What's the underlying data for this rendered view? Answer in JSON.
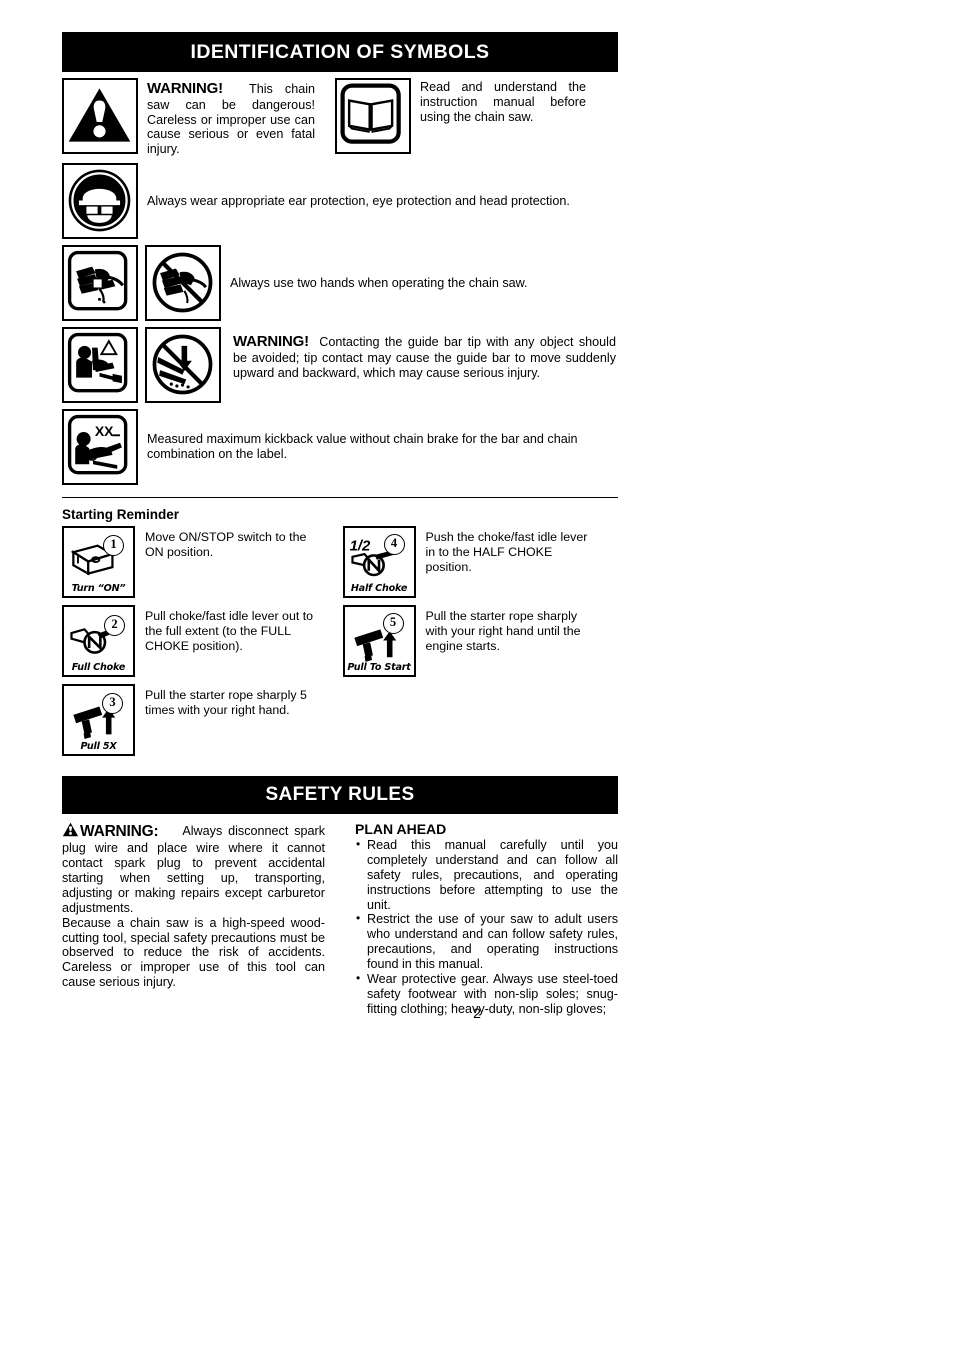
{
  "sections": {
    "identification": {
      "title": "IDENTIFICATION OF SYMBOLS",
      "rows": [
        {
          "icons": [
            "warning-triangle-icon"
          ],
          "warning_label": "WARNING!",
          "text": "This chain saw can be dangerous! Careless or improper use can cause serious or even fatal injury."
        },
        {
          "icons": [
            "instruction-manual-book-icon"
          ],
          "text": "Read and understand the instruction manual before using the chain saw."
        },
        {
          "icons": [
            "head-eye-ear-protection-icon"
          ],
          "text": "Always wear appropriate ear protection, eye protection and head protection."
        },
        {
          "icons": [
            "two-hands-icon",
            "one-hand-prohibited-icon"
          ],
          "text": "Always use two hands when operating the chain saw."
        },
        {
          "icons": [
            "kickback-operator-icon",
            "bar-tip-contact-prohibited-icon"
          ],
          "warning_label": "WARNING!",
          "text": "Contacting the guide bar tip with any object should be avoided; tip contact may cause the guide bar to move suddenly upward and backward, which may cause serious injury."
        },
        {
          "icons": [
            "kickback-value-xx-icon"
          ],
          "icon_value": "XX",
          "text": "Measured maximum kickback value without chain brake for the bar and chain combination on the label."
        }
      ]
    },
    "starting_reminder": {
      "title": "Starting Reminder",
      "left_steps": [
        {
          "number": "1",
          "caption": "Turn “ON”",
          "icon": "on-stop-switch-icon",
          "text": "Move ON/STOP switch to the ON position."
        },
        {
          "number": "2",
          "caption": "Full Choke",
          "icon": "choke-lever-full-icon",
          "text": "Pull choke/fast idle lever out to the full extent (to the FULL CHOKE position)."
        },
        {
          "number": "3",
          "caption": "Pull 5X",
          "icon": "starter-rope-handle-icon",
          "text": "Pull the starter rope sharply 5 times with your right hand."
        }
      ],
      "right_steps": [
        {
          "number": "4",
          "caption": "Half Choke",
          "icon": "choke-lever-half-icon",
          "icon_label": "1/2",
          "text": "Push the choke/fast idle lever in to the HALF CHOKE position."
        },
        {
          "number": "5",
          "caption": "Pull To Start",
          "icon": "starter-rope-handle-icon",
          "text": "Pull the starter rope sharply with your right hand until the engine starts."
        }
      ]
    },
    "safety_rules": {
      "title": "SAFETY RULES",
      "warning_label": "WARNING:",
      "warning_body": "Always disconnect spark plug wire and place wire where it cannot contact spark plug to prevent accidental starting when setting up, transporting, adjusting or making repairs except carburetor adjustments.",
      "warning_body2": "Because a chain saw is a high-speed wood-cutting tool, special safety precautions must be observed to reduce the risk of accidents. Careless or improper use of this tool can cause serious injury.",
      "plan_ahead_title": "PLAN AHEAD",
      "plan_ahead_bullets": [
        "Read this manual carefully until you completely understand and can follow all safety rules, precautions, and operating instructions before attempting to use the unit.",
        "Restrict the use of your saw to adult users who understand and can follow safety rules, precautions, and operating instructions found in this manual.",
        "Wear protective gear.  Always use steel-toed safety footwear with non-slip soles; snug-fitting clothing; heavy-duty, non-slip gloves;"
      ]
    }
  },
  "footer": {
    "page_number": "2"
  },
  "colors": {
    "ink": "#000000",
    "paper": "#ffffff",
    "header_bar": "#000000",
    "header_text": "#ffffff"
  }
}
